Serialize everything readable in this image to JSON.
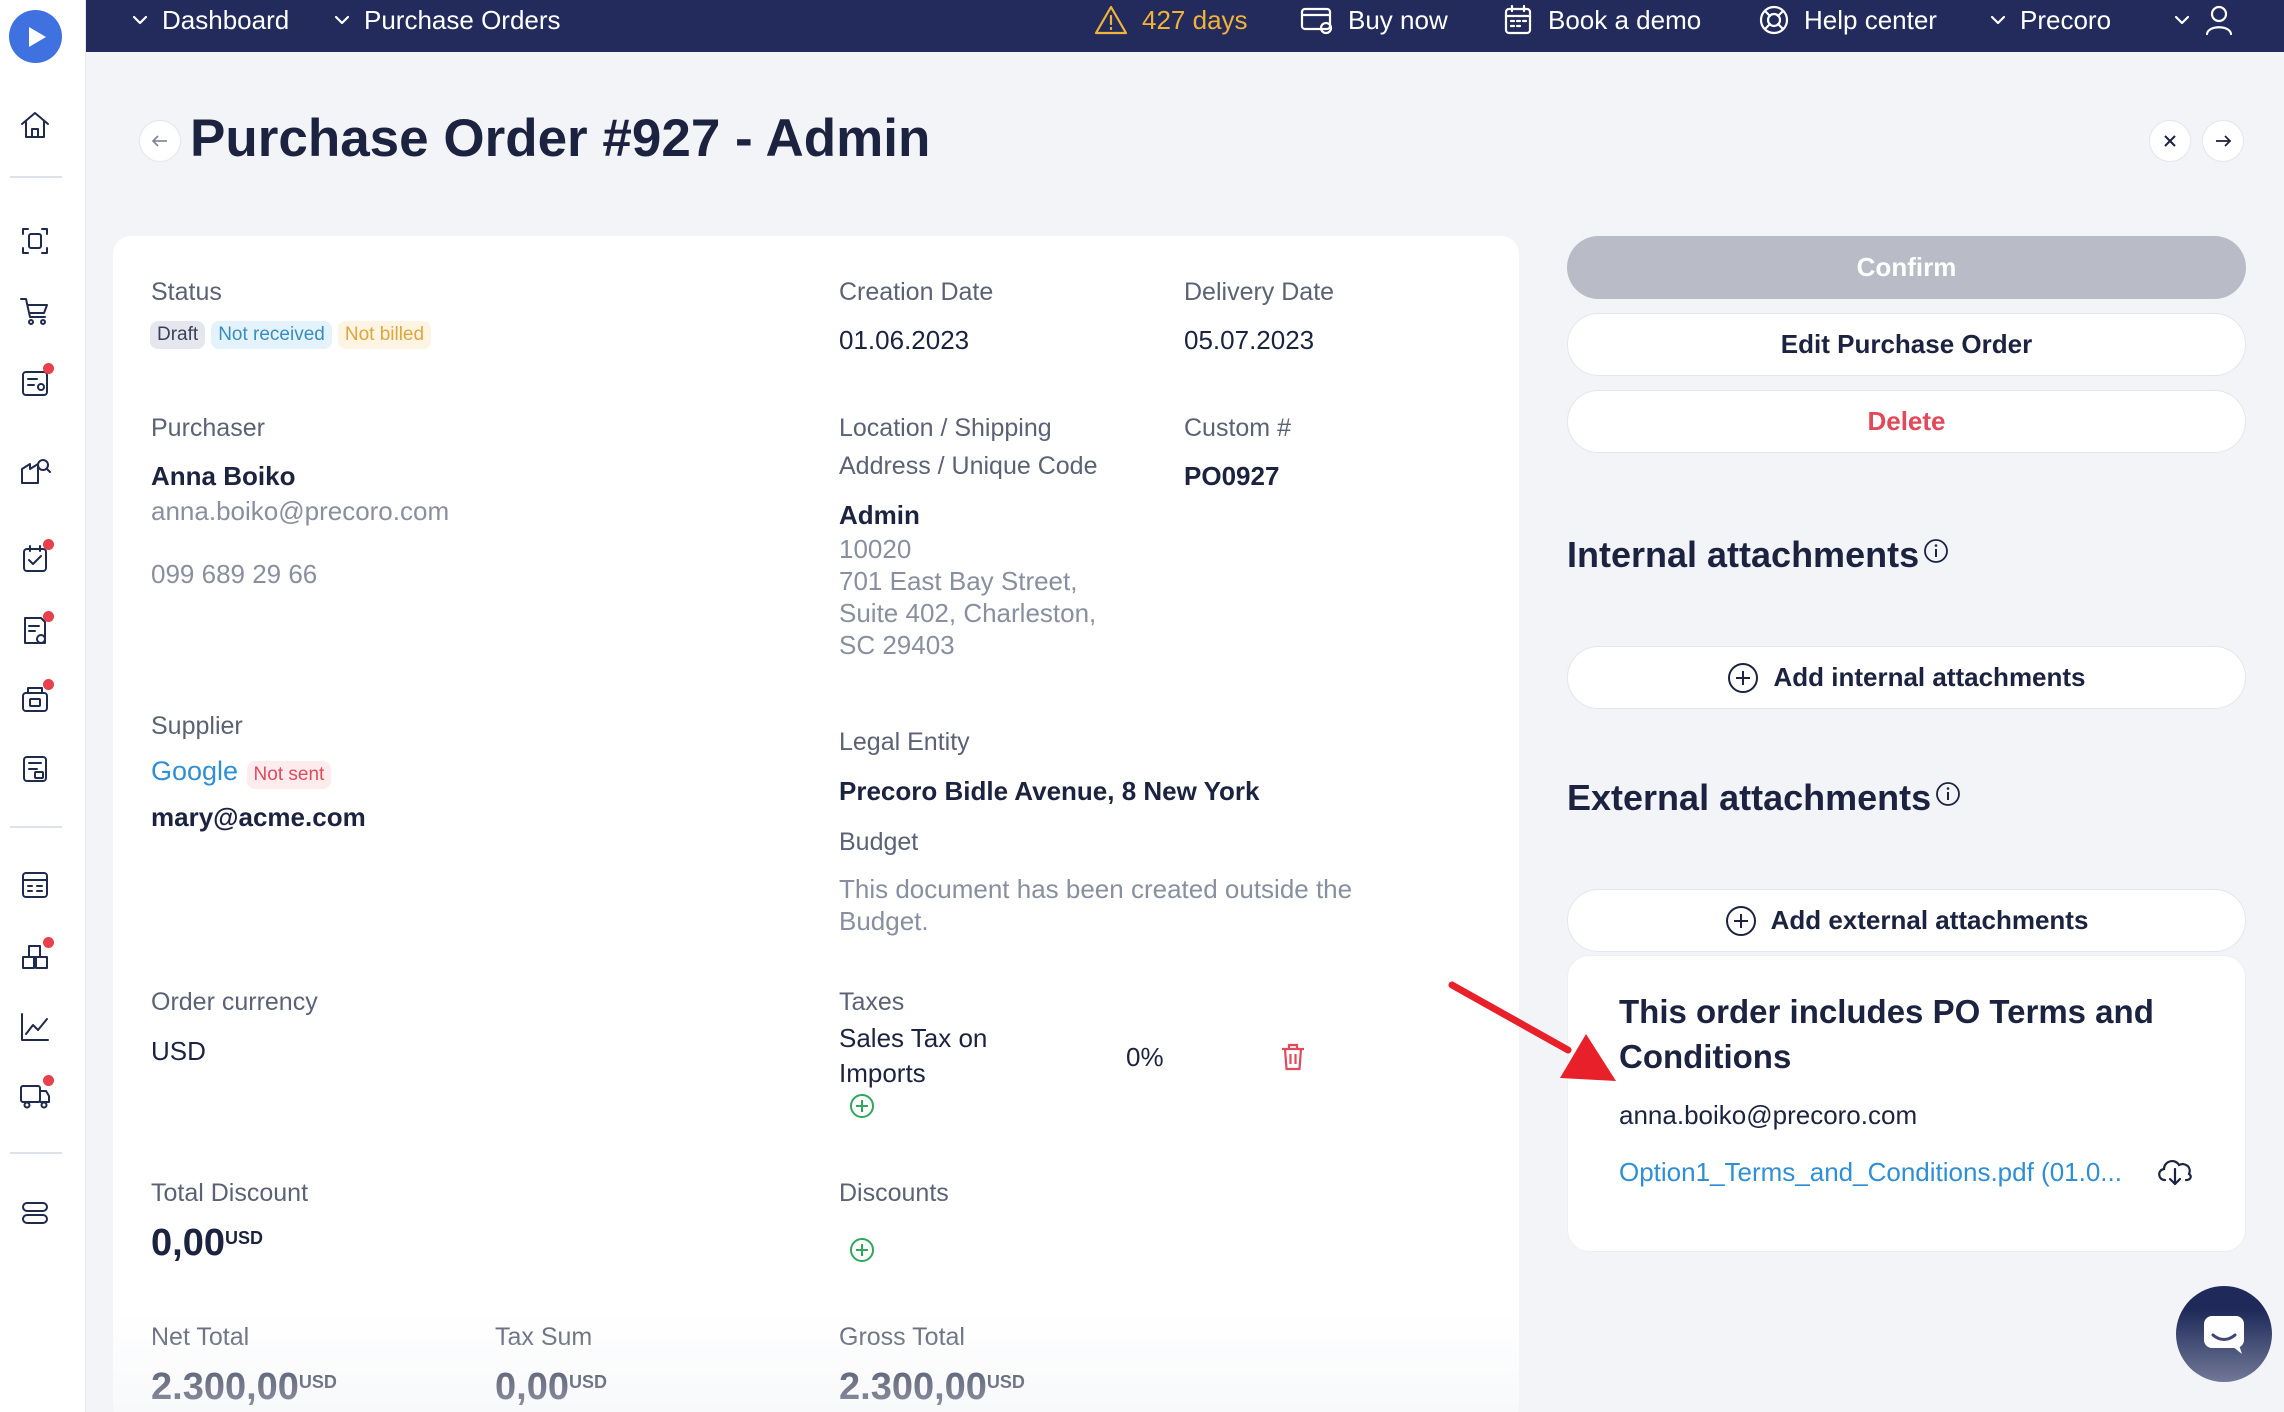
{
  "topbar": {
    "dashboard": "Dashboard",
    "purchase_orders": "Purchase Orders",
    "trial_days": "427 days",
    "buy_now": "Buy now",
    "book_demo": "Book a demo",
    "help_center": "Help center",
    "company": "Precoro"
  },
  "page": {
    "title": "Purchase Order #927 - Admin"
  },
  "details": {
    "status_label": "Status",
    "badges": [
      "Draft",
      "Not received",
      "Not billed"
    ],
    "creation_date_label": "Creation Date",
    "creation_date": "01.06.2023",
    "delivery_date_label": "Delivery Date",
    "delivery_date": "05.07.2023",
    "purchaser_label": "Purchaser",
    "purchaser_name": "Anna Boiko",
    "purchaser_email": "anna.boiko@precoro.com",
    "purchaser_phone": "099 689 29 66",
    "location_label_1": "Location / Shipping",
    "location_label_2": "Address / Unique Code",
    "location_name": "Admin",
    "location_code": "10020",
    "address_line_1": "701 East Bay Street,",
    "address_line_2": "Suite 402, Charleston,",
    "address_line_3": "SC 29403",
    "custom_label": "Custom #",
    "custom_value": "PO0927",
    "supplier_label": "Supplier",
    "supplier_name": "Google",
    "supplier_badge": "Not sent",
    "supplier_email": "mary@acme.com",
    "legal_entity_label": "Legal Entity",
    "legal_entity": "Precoro Bidle Avenue, 8 New York",
    "budget_label": "Budget",
    "budget_line_1": "This document has been created outside the",
    "budget_line_2": "Budget.",
    "currency_label": "Order currency",
    "currency": "USD",
    "taxes_label": "Taxes",
    "tax_name_1": "Sales Tax on",
    "tax_name_2": "Imports",
    "tax_rate": "0%",
    "total_discount_label": "Total Discount",
    "total_discount": "0,00",
    "discounts_label": "Discounts",
    "net_total_label": "Net Total",
    "net_total": "2.300,00",
    "tax_sum_label": "Tax Sum",
    "tax_sum": "0,00",
    "gross_total_label": "Gross Total",
    "gross_total": "2.300,00",
    "currency_code": "USD"
  },
  "actions": {
    "confirm": "Confirm",
    "edit": "Edit Purchase Order",
    "delete": "Delete"
  },
  "attachments": {
    "internal_title": "Internal attachments",
    "add_internal": "Add internal attachments",
    "external_title": "External attachments",
    "add_external": "Add external attachments",
    "terms_title_1": "This order includes PO Terms and",
    "terms_title_2": "Conditions",
    "terms_email": "anna.boiko@precoro.com",
    "terms_file": "Option1_Terms_and_Conditions.pdf (01.0..."
  },
  "colors": {
    "topbar": "#222b5c",
    "accent_link": "#2f8fd6",
    "danger": "#e24a5a",
    "warning": "#f2b13a",
    "annotation_arrow": "#e8202a"
  }
}
